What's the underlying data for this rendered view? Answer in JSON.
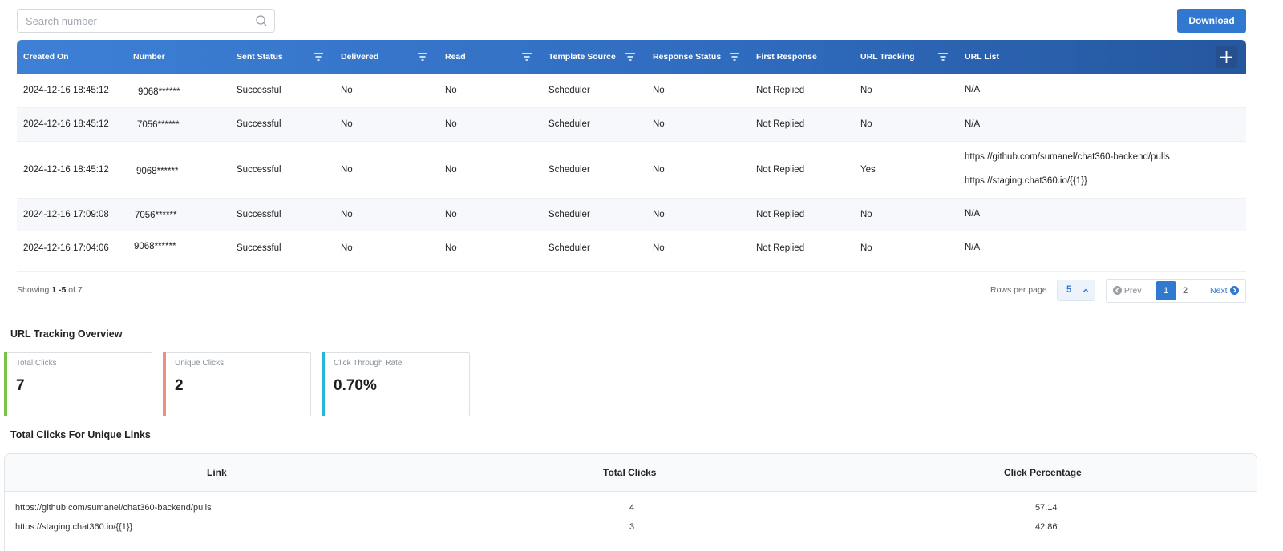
{
  "search": {
    "placeholder": "Search number"
  },
  "toolbar": {
    "download_label": "Download"
  },
  "table": {
    "headers": [
      "Created On",
      "Number",
      "Sent Status",
      "Delivered",
      "Read",
      "Template Source",
      "Response Status",
      "First Response",
      "URL Tracking",
      "URL List"
    ],
    "rows": [
      [
        "2024-12-16 18:45:12",
        "9068******",
        "Successful",
        "No",
        "No",
        "Scheduler",
        "No",
        "Not Replied",
        "No",
        "N/A",
        ""
      ],
      [
        "2024-12-16 18:45:12",
        "7056******",
        "Successful",
        "No",
        "No",
        "Scheduler",
        "No",
        "Not Replied",
        "No",
        "N/A",
        ""
      ],
      [
        "2024-12-16 18:45:12",
        "9068******",
        "Successful",
        "No",
        "No",
        "Scheduler",
        "No",
        "Not Replied",
        "Yes",
        "https://github.com/sumanel/chat360-backend/pulls",
        "https://staging.chat360.io/{{1}}"
      ],
      [
        "2024-12-16 17:09:08",
        "7056******",
        "Successful",
        "No",
        "No",
        "Scheduler",
        "No",
        "Not Replied",
        "No",
        "N/A",
        ""
      ],
      [
        "2024-12-16 17:04:06",
        "9068******",
        "Successful",
        "No",
        "No",
        "Scheduler",
        "No",
        "Not Replied",
        "No",
        "N/A",
        ""
      ]
    ]
  },
  "pagination": {
    "showing_prefix": "Showing",
    "showing_range": "1 -5",
    "showing_suffix": "of 7",
    "rows_per_page_label": "Rows per page",
    "rows_per_page_value": "5",
    "prev_label": "Prev",
    "next_label": "Next",
    "pages": [
      "1",
      "2"
    ],
    "current_page": "1"
  },
  "overview": {
    "title": "URL Tracking Overview",
    "cards": [
      {
        "label": "Total Clicks",
        "value": "7",
        "color": "#7cc24a"
      },
      {
        "label": "Unique Clicks",
        "value": "2",
        "color": "#ef8f7f"
      },
      {
        "label": "Click Through Rate",
        "value": "0.70%",
        "color": "#27b6d8"
      }
    ]
  },
  "links": {
    "title": "Total Clicks For Unique Links",
    "headers": [
      "Link",
      "Total Clicks",
      "Click Percentage"
    ],
    "rows": [
      [
        "https://github.com/sumanel/chat360-backend/pulls",
        "4",
        "57.14"
      ],
      [
        "https://staging.chat360.io/{{1}}",
        "3",
        "42.86"
      ]
    ]
  },
  "colors": {
    "accent": "#3178d0",
    "header_start": "#3d80d6",
    "header_end": "#25579f"
  }
}
